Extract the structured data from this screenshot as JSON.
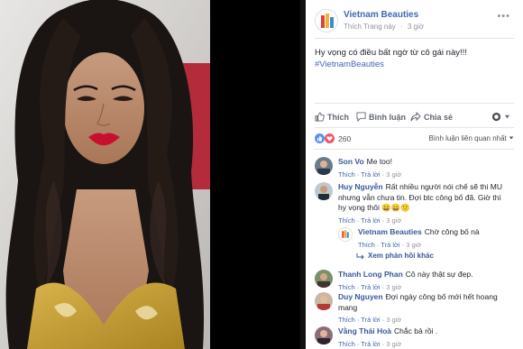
{
  "post": {
    "page_name": "Vietnam Beauties",
    "like_page": "Thích Trang này",
    "dot": "·",
    "time": "3 giờ",
    "more": "•••",
    "text": "Hy vọng có điều bất ngờ từ cô gái này!!!",
    "hashtag": "#VietnamBeauties"
  },
  "actions": {
    "like": "Thích",
    "comment": "Bình luận",
    "share": "Chia sẻ"
  },
  "reactions": {
    "count": "260",
    "sort": "Bình luận liên quan nhất"
  },
  "comments": [
    {
      "author": "Son Vo",
      "text": "Me too!",
      "like": "Thích",
      "reply": "Trả lời",
      "time": "3 giờ"
    },
    {
      "author": "Huy Nguyễn",
      "text": "Rất nhiều người nói chế sẽ thi MU nhưng vẫn chưa tin. Đợi btc công bố đã. Giờ thì hy vọng thôi 😄😄🙂",
      "like": "Thích",
      "reply": "Trả lời",
      "time": "3 giờ"
    },
    {
      "author": "Vietnam Beauties",
      "text": "Chờ công bố nà",
      "like": "Thích",
      "reply": "Trả lời",
      "time": "3 giờ"
    },
    {
      "author": "Thanh Long Phan",
      "text": "Cô này thật sự đẹp.",
      "like": "Thích",
      "reply": "Trả lời",
      "time": "3 giờ"
    },
    {
      "author": "Duy Nguyen",
      "text": "Đợi ngày công bố mới hết hoang mang",
      "like": "Thích",
      "reply": "Trả lời",
      "time": "3 giờ"
    },
    {
      "author": "Vằng Thái Hoà",
      "text": "Chắc bả rồi .",
      "like": "Thích",
      "reply": "Trả lời",
      "time": "3 giờ"
    }
  ],
  "more_replies": "Xem phản hồi khác",
  "colors": {
    "link": "#4267b2",
    "author": "#385898",
    "like_reaction": "#5890ff",
    "love_reaction": "#f25268",
    "lipstick": "#c8102e",
    "dress_gold": "#c9a23a"
  }
}
